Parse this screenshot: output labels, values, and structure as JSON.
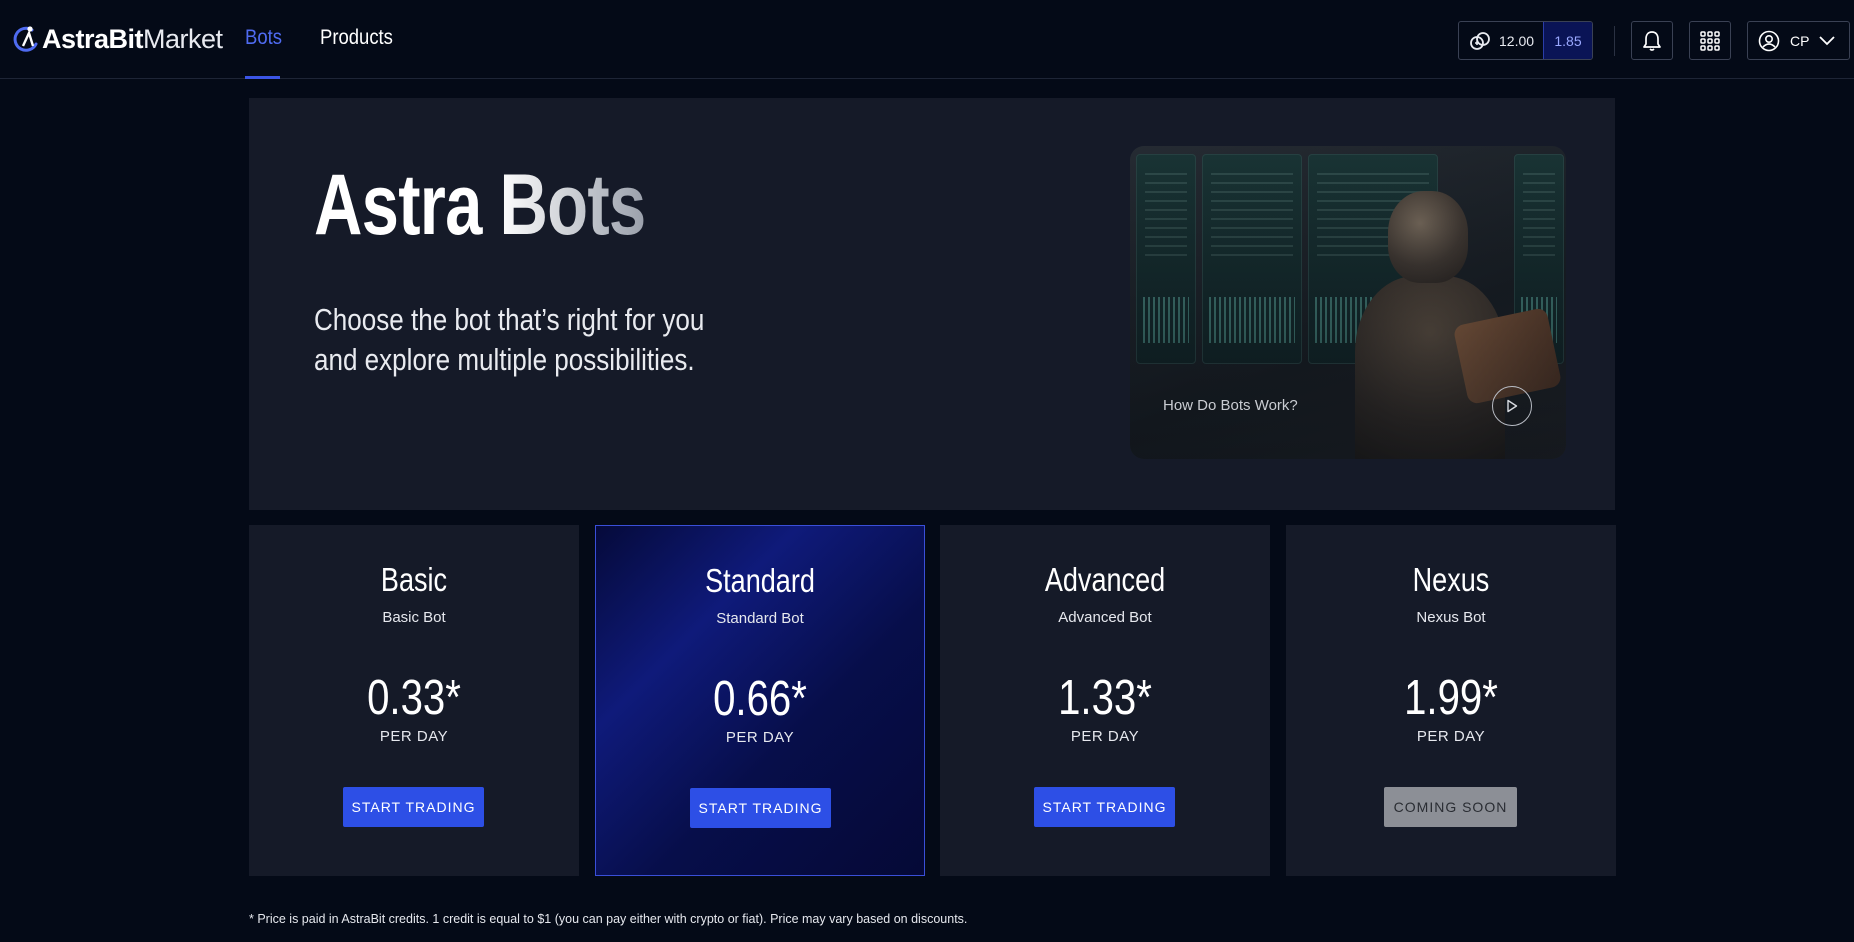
{
  "header": {
    "logo": {
      "bold": "AstraBit",
      "light": "Market"
    },
    "nav": [
      {
        "label": "Bots",
        "active": true
      },
      {
        "label": "Products",
        "active": false
      }
    ],
    "credits": {
      "balance": "12.00",
      "secondary": "1.85"
    },
    "profile": {
      "initials": "CP"
    },
    "icons": [
      "credits-icon",
      "bell-icon",
      "apps-grid-icon",
      "user-icon",
      "chevron-down-icon"
    ]
  },
  "hero": {
    "title": "Astra Bots",
    "subtitle_line1": "Choose the bot that’s right for you",
    "subtitle_line2": "and explore multiple possibilities.",
    "video_label": "How Do Bots Work?"
  },
  "plans": [
    {
      "name": "Basic",
      "desc": "Basic Bot",
      "price": "0.33*",
      "per": "PER DAY",
      "button": "START TRADING",
      "featured": false
    },
    {
      "name": "Standard",
      "desc": "Standard Bot",
      "price": "0.66*",
      "per": "PER DAY",
      "button": "START TRADING",
      "featured": true
    },
    {
      "name": "Advanced",
      "desc": "Advanced Bot",
      "price": "1.33*",
      "per": "PER DAY",
      "button": "START TRADING",
      "featured": false
    },
    {
      "name": "Nexus",
      "desc": "Nexus Bot",
      "price": "1.99*",
      "per": "PER DAY",
      "button": "COMING SOON",
      "featured": false
    }
  ],
  "footnote": "* Price is paid in AstraBit credits. 1 credit is equal to $1 (you can pay either with crypto or fiat). Price may vary based on discounts.",
  "colors": {
    "accent": "#2d4fe6",
    "nav_active": "#4f6bf0",
    "background": "#040a17",
    "panel": "#151a28"
  }
}
